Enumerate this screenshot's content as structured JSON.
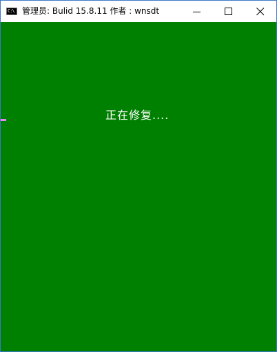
{
  "window": {
    "title": "管理员:  Bulid 15.8.11    作者 : wnsdt",
    "icon": "console-icon",
    "icon_text": "C:\\",
    "controls": [
      "minimize-icon",
      "maximize-icon",
      "close-icon"
    ]
  },
  "console": {
    "background": "#008000",
    "text_color": "#ffffff",
    "message": "正在修复...."
  },
  "colors": {
    "window_border": "#3b78c6",
    "titlebar": "#ffffff"
  }
}
